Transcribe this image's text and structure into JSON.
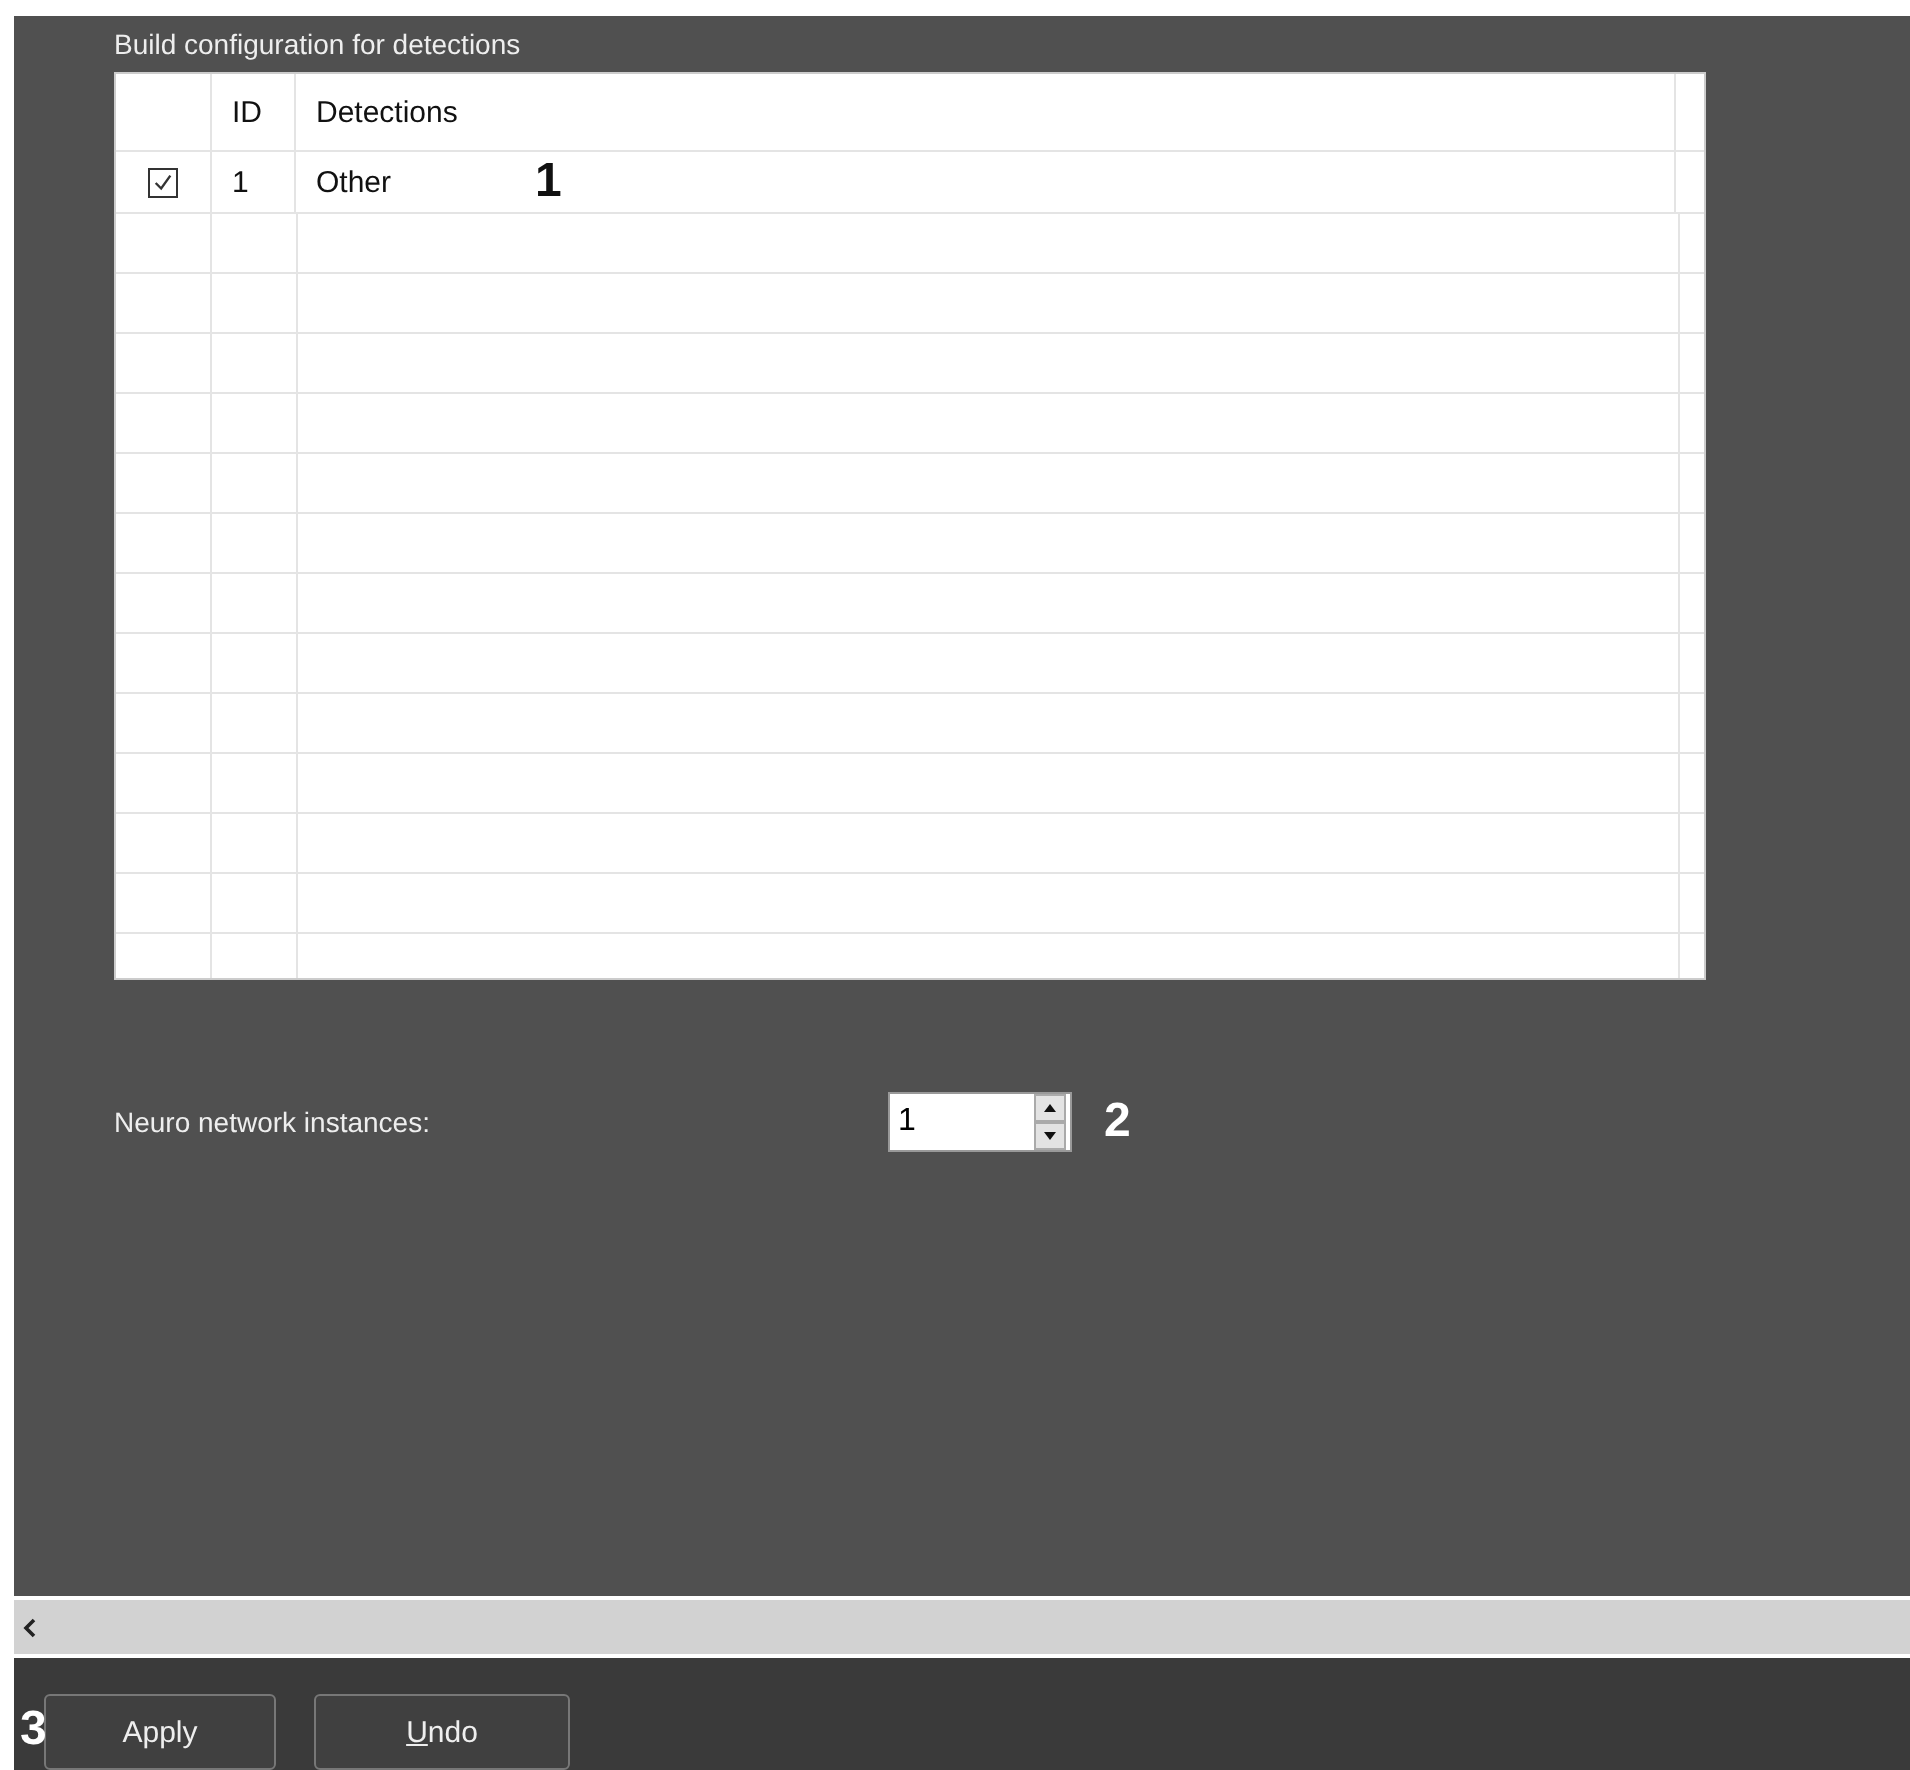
{
  "panel": {
    "title": "Build configuration for detections"
  },
  "table": {
    "columns": [
      "ID",
      "Detections"
    ],
    "rows": [
      {
        "checked": true,
        "id": "1",
        "detection": "Other"
      }
    ],
    "annotation": "1"
  },
  "instances": {
    "label": "Neuro network instances:",
    "value": "1",
    "annotation": "2"
  },
  "buttons": [
    {
      "label": "Apply",
      "mnemonic": false
    },
    {
      "label": "Undo",
      "mnemonic": true
    }
  ],
  "buttons_annotation": "3"
}
